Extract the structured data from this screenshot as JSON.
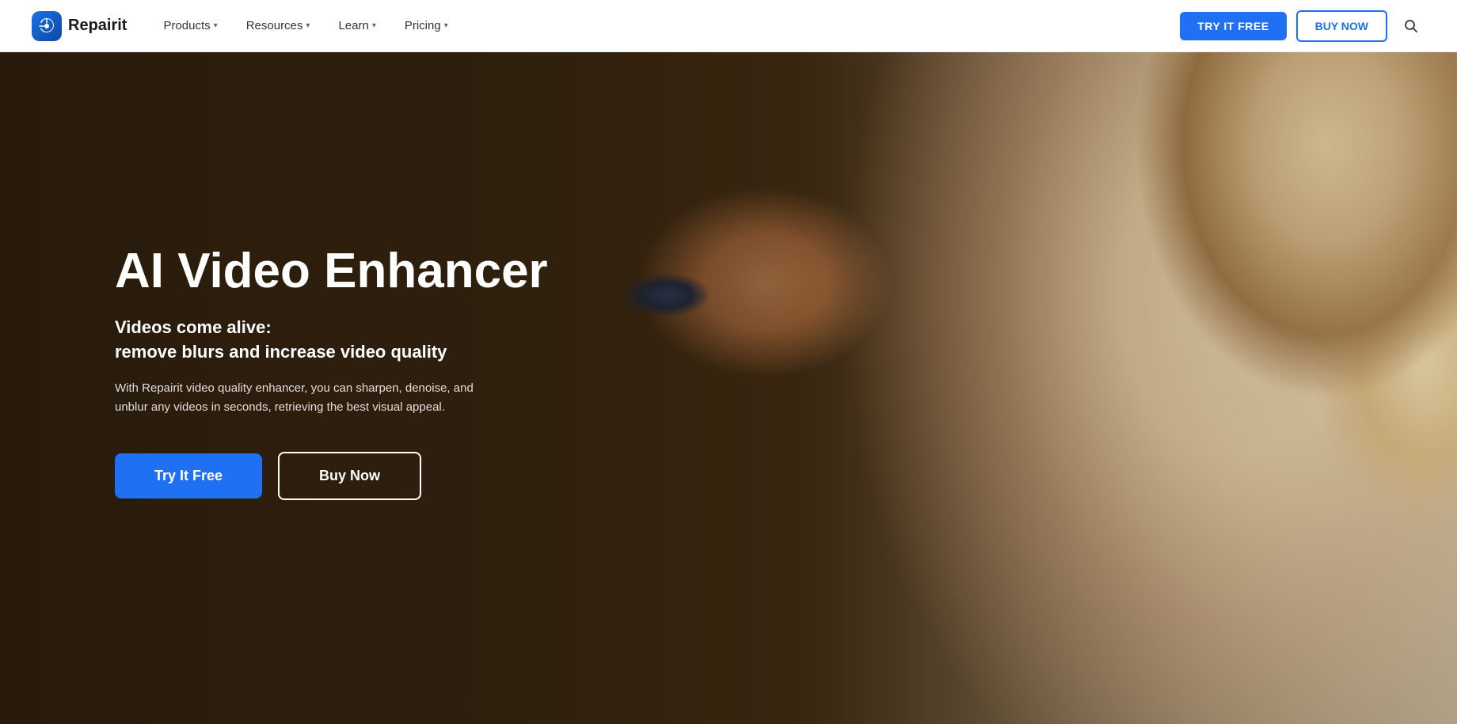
{
  "navbar": {
    "brand": {
      "logo_text": "R",
      "name": "Repairit"
    },
    "nav_items": [
      {
        "label": "Products",
        "has_dropdown": true
      },
      {
        "label": "Resources",
        "has_dropdown": true
      },
      {
        "label": "Learn",
        "has_dropdown": true
      },
      {
        "label": "Pricing",
        "has_dropdown": true
      }
    ],
    "btn_try_free": "TRY IT FREE",
    "btn_buy_now": "BUY NOW",
    "search_aria": "Search"
  },
  "hero": {
    "title": "AI Video Enhancer",
    "subtitle": "Videos come alive:\nremove blurs and increase video quality",
    "description": "With Repairit video quality enhancer, you can sharpen, denoise, and unblur any videos in seconds, retrieving the best visual appeal.",
    "btn_try_free": "Try It Free",
    "btn_buy_now": "Buy Now"
  }
}
